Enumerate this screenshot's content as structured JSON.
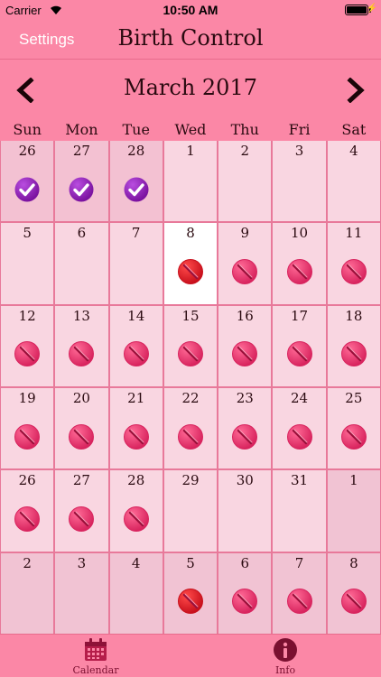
{
  "status": {
    "carrier": "Carrier",
    "time": "10:50 AM"
  },
  "navbar": {
    "settings": "Settings",
    "title": "Birth Control"
  },
  "month": {
    "label": "March 2017"
  },
  "weekdays": [
    "Sun",
    "Mon",
    "Tue",
    "Wed",
    "Thu",
    "Fri",
    "Sat"
  ],
  "colors": {
    "accent": "#fb87a6",
    "pill": "#e8356d",
    "check": "#8a1cb4",
    "today_pill": "#e0202a"
  },
  "weeks": [
    [
      {
        "day": "26",
        "state": "past",
        "icon": "check"
      },
      {
        "day": "27",
        "state": "past",
        "icon": "check"
      },
      {
        "day": "28",
        "state": "past",
        "icon": "check"
      },
      {
        "day": "1",
        "state": "normal",
        "icon": ""
      },
      {
        "day": "2",
        "state": "normal",
        "icon": ""
      },
      {
        "day": "3",
        "state": "normal",
        "icon": ""
      },
      {
        "day": "4",
        "state": "normal",
        "icon": ""
      }
    ],
    [
      {
        "day": "5",
        "state": "normal",
        "icon": ""
      },
      {
        "day": "6",
        "state": "normal",
        "icon": ""
      },
      {
        "day": "7",
        "state": "normal",
        "icon": ""
      },
      {
        "day": "8",
        "state": "today",
        "icon": "pill-red"
      },
      {
        "day": "9",
        "state": "normal",
        "icon": "pill"
      },
      {
        "day": "10",
        "state": "normal",
        "icon": "pill"
      },
      {
        "day": "11",
        "state": "normal",
        "icon": "pill"
      }
    ],
    [
      {
        "day": "12",
        "state": "normal",
        "icon": "pill"
      },
      {
        "day": "13",
        "state": "normal",
        "icon": "pill"
      },
      {
        "day": "14",
        "state": "normal",
        "icon": "pill"
      },
      {
        "day": "15",
        "state": "normal",
        "icon": "pill"
      },
      {
        "day": "16",
        "state": "normal",
        "icon": "pill"
      },
      {
        "day": "17",
        "state": "normal",
        "icon": "pill"
      },
      {
        "day": "18",
        "state": "normal",
        "icon": "pill"
      }
    ],
    [
      {
        "day": "19",
        "state": "normal",
        "icon": "pill"
      },
      {
        "day": "20",
        "state": "normal",
        "icon": "pill"
      },
      {
        "day": "21",
        "state": "normal",
        "icon": "pill"
      },
      {
        "day": "22",
        "state": "normal",
        "icon": "pill"
      },
      {
        "day": "23",
        "state": "normal",
        "icon": "pill"
      },
      {
        "day": "24",
        "state": "normal",
        "icon": "pill"
      },
      {
        "day": "25",
        "state": "normal",
        "icon": "pill"
      }
    ],
    [
      {
        "day": "26",
        "state": "normal",
        "icon": "pill"
      },
      {
        "day": "27",
        "state": "normal",
        "icon": "pill"
      },
      {
        "day": "28",
        "state": "normal",
        "icon": "pill"
      },
      {
        "day": "29",
        "state": "normal",
        "icon": ""
      },
      {
        "day": "30",
        "state": "normal",
        "icon": ""
      },
      {
        "day": "31",
        "state": "normal",
        "icon": ""
      },
      {
        "day": "1",
        "state": "other",
        "icon": ""
      }
    ],
    [
      {
        "day": "2",
        "state": "other",
        "icon": ""
      },
      {
        "day": "3",
        "state": "other",
        "icon": ""
      },
      {
        "day": "4",
        "state": "other",
        "icon": ""
      },
      {
        "day": "5",
        "state": "other",
        "icon": "pill-red"
      },
      {
        "day": "6",
        "state": "other",
        "icon": "pill"
      },
      {
        "day": "7",
        "state": "other",
        "icon": "pill"
      },
      {
        "day": "8",
        "state": "other",
        "icon": "pill"
      }
    ]
  ],
  "tabs": {
    "calendar": "Calendar",
    "info": "Info"
  }
}
